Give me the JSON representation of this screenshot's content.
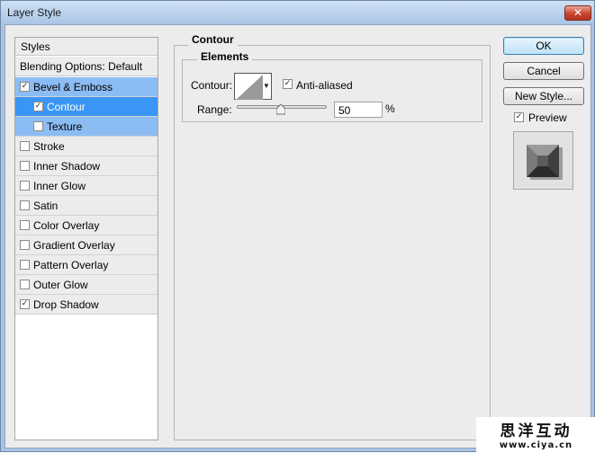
{
  "window": {
    "title": "Layer Style",
    "close_glyph": "✕"
  },
  "styles": {
    "header": "Styles",
    "blending_options": "Blending Options: Default",
    "items": [
      {
        "label": "Bevel & Emboss",
        "checked": true
      },
      {
        "label": "Contour",
        "checked": true
      },
      {
        "label": "Texture",
        "checked": false
      },
      {
        "label": "Stroke",
        "checked": false
      },
      {
        "label": "Inner Shadow",
        "checked": false
      },
      {
        "label": "Inner Glow",
        "checked": false
      },
      {
        "label": "Satin",
        "checked": false
      },
      {
        "label": "Color Overlay",
        "checked": false
      },
      {
        "label": "Gradient Overlay",
        "checked": false
      },
      {
        "label": "Pattern Overlay",
        "checked": false
      },
      {
        "label": "Outer Glow",
        "checked": false
      },
      {
        "label": "Drop Shadow",
        "checked": true
      }
    ]
  },
  "contour_panel": {
    "group_title": "Contour",
    "elements_title": "Elements",
    "contour_label": "Contour:",
    "anti_aliased_label": "Anti-aliased",
    "anti_aliased_checked": true,
    "range_label": "Range:",
    "range_value": "50",
    "range_unit": "%",
    "range_fraction": 0.5
  },
  "buttons": {
    "ok": "OK",
    "cancel": "Cancel",
    "new_style": "New Style..."
  },
  "preview": {
    "label": "Preview",
    "checked": true
  },
  "checkmark": "✓",
  "colors": {
    "selected": "#3a96f6",
    "selected_light": "#8cbcf4"
  },
  "watermark": {
    "chinese": "思洋互动",
    "url": "www.ciya.cn"
  }
}
